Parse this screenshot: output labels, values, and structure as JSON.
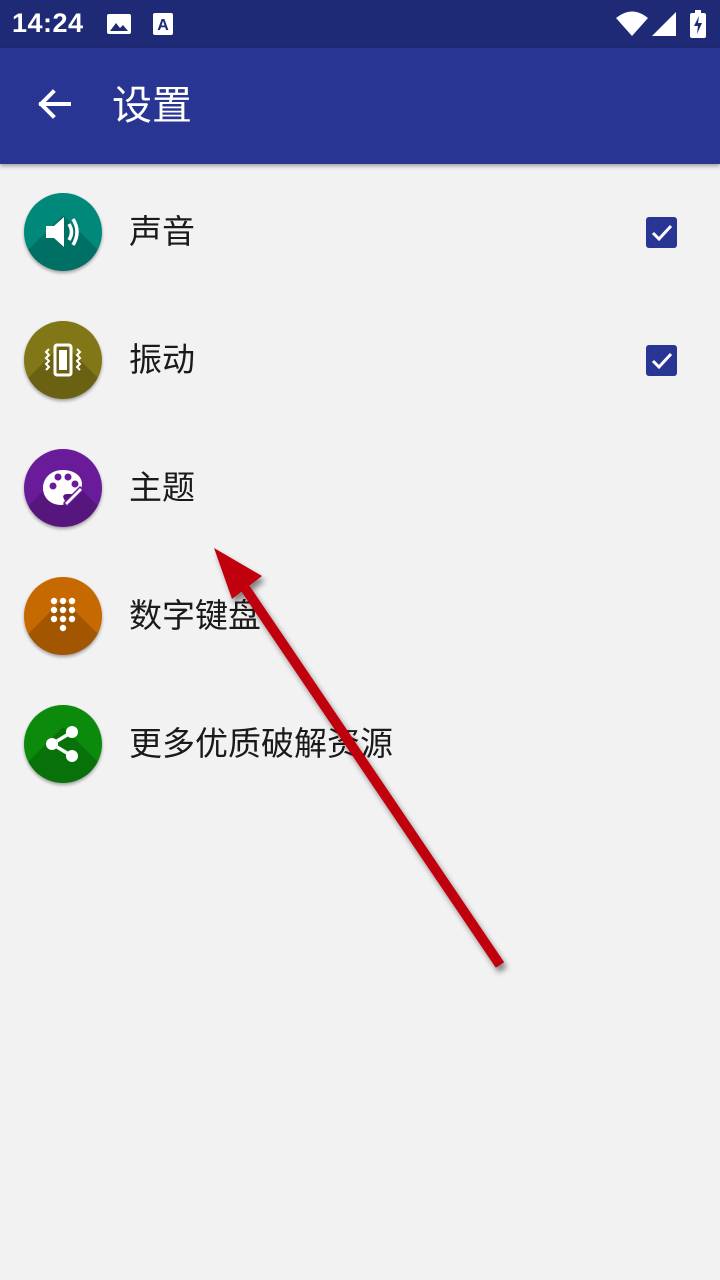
{
  "status_bar": {
    "time": "14:24",
    "icons": [
      "image-notification-icon",
      "a-app-notification-icon",
      "wifi-icon",
      "cell-signal-icon",
      "battery-charging-icon"
    ]
  },
  "app_bar": {
    "back_icon": "arrow-back-icon",
    "title": "设置",
    "color": "#283593"
  },
  "settings": [
    {
      "label": "声音",
      "icon": "volume-icon",
      "color": "#00897b",
      "checkbox": true,
      "checked": true
    },
    {
      "label": "振动",
      "icon": "vibration-icon",
      "color": "#827717",
      "checkbox": true,
      "checked": true
    },
    {
      "label": "主题",
      "icon": "palette-icon",
      "color": "#6a1b9a",
      "checkbox": false
    },
    {
      "label": "数字键盘",
      "icon": "dialpad-icon",
      "color": "#c66900",
      "checkbox": false
    },
    {
      "label": "更多优质破解资源",
      "icon": "share-icon",
      "color": "#0c8a0c",
      "checkbox": false
    }
  ],
  "annotation": {
    "type": "arrow",
    "color": "#c0000b",
    "points_to": "主题"
  }
}
